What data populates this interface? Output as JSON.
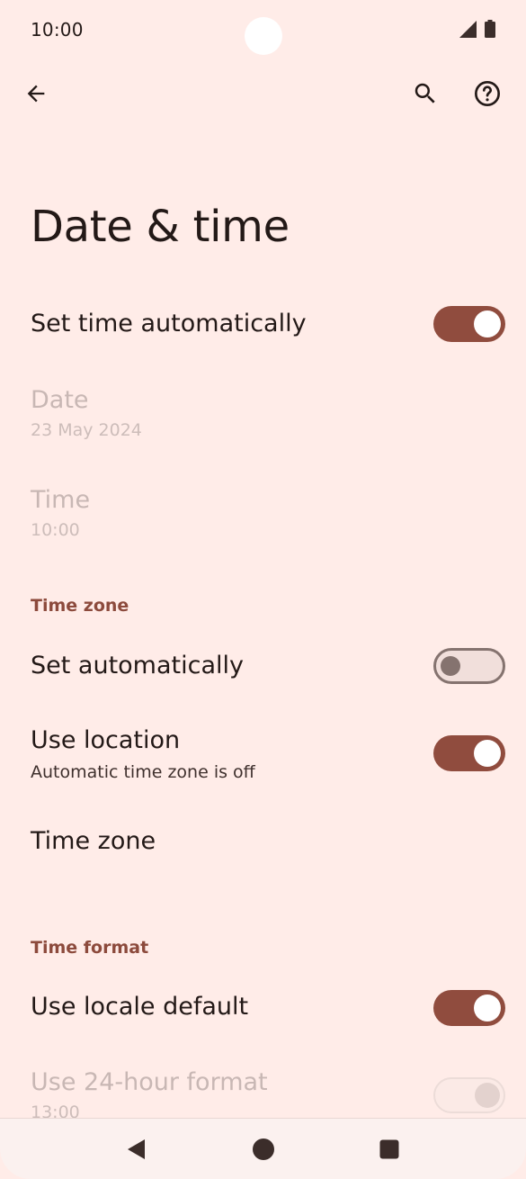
{
  "status_bar": {
    "time": "10:00"
  },
  "app_bar": {
    "back_icon": "arrow-back-icon",
    "search_icon": "search-icon",
    "help_icon": "help-circle-icon"
  },
  "page": {
    "title": "Date & time"
  },
  "settings": {
    "set_time_automatically": {
      "label": "Set time automatically",
      "state": "on"
    },
    "date": {
      "label": "Date",
      "value": "23 May 2024",
      "enabled": false
    },
    "time": {
      "label": "Time",
      "value": "10:00",
      "enabled": false
    },
    "time_zone_section": {
      "header": "Time zone",
      "set_automatically": {
        "label": "Set automatically",
        "state": "off"
      },
      "use_location": {
        "label": "Use location",
        "summary": "Automatic time zone is off",
        "state": "on"
      },
      "time_zone": {
        "label": "Time zone"
      }
    },
    "time_format_section": {
      "header": "Time format",
      "use_locale_default": {
        "label": "Use locale default",
        "state": "on"
      },
      "use_24_hour": {
        "label": "Use 24-hour format",
        "summary": "13:00",
        "state": "on",
        "enabled": false
      }
    }
  },
  "nav_bar": {
    "back_icon": "nav-back-triangle-icon",
    "home_icon": "nav-home-circle-icon",
    "recents_icon": "nav-recents-square-icon"
  },
  "colors": {
    "background": "#ffece8",
    "accent": "#904c3e",
    "section_header": "#8c4a3c",
    "text_primary": "#231917",
    "text_disabled": "#c8b7b4"
  }
}
